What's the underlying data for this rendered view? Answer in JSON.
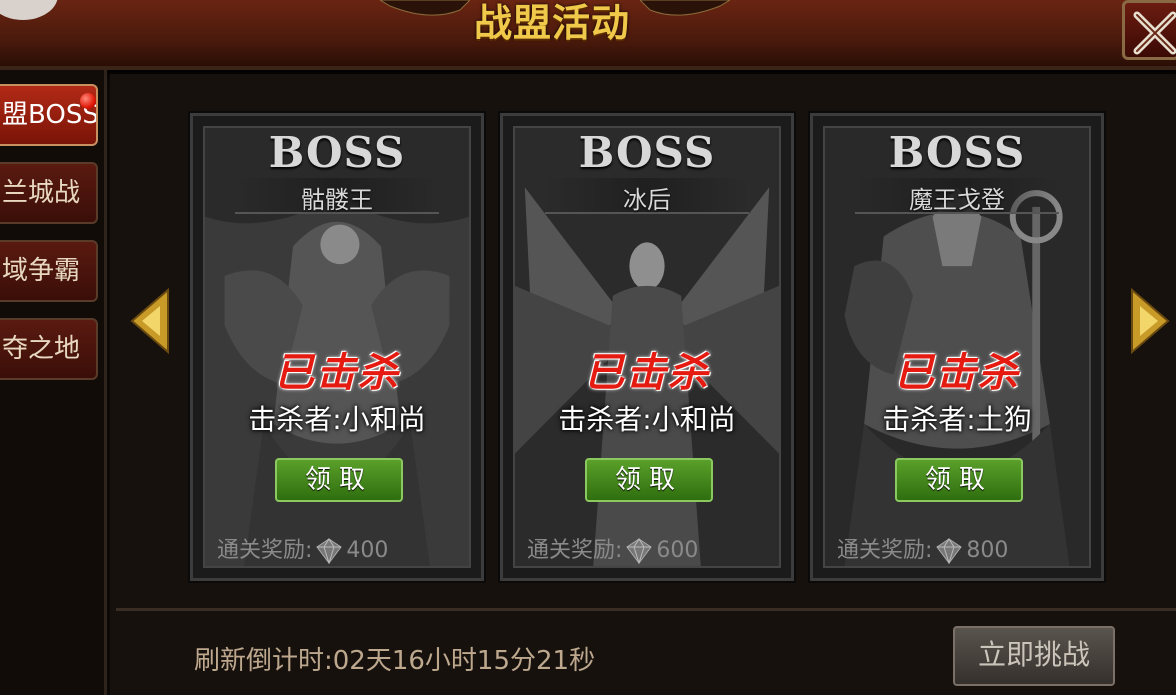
{
  "header": {
    "title": "战盟活动"
  },
  "sidebar": {
    "tabs": [
      {
        "label": "盟BOSS",
        "active": true,
        "badge": true
      },
      {
        "label": "兰城战",
        "active": false
      },
      {
        "label": "域争霸",
        "active": false
      },
      {
        "label": "夺之地",
        "active": false
      }
    ]
  },
  "cards": [
    {
      "header": "BOSS",
      "name": "骷髅王",
      "status": "已击杀",
      "killer": "击杀者:小和尚",
      "button": "领取",
      "reward_label": "通关奖励:",
      "reward_value": "400"
    },
    {
      "header": "BOSS",
      "name": "冰后",
      "status": "已击杀",
      "killer": "击杀者:小和尚",
      "button": "领取",
      "reward_label": "通关奖励:",
      "reward_value": "600"
    },
    {
      "header": "BOSS",
      "name": "魔王戈登",
      "status": "已击杀",
      "killer": "击杀者:土狗",
      "button": "领取",
      "reward_label": "通关奖励:",
      "reward_value": "800"
    }
  ],
  "footer": {
    "countdown": "刷新倒计时:02天16小时15分21秒",
    "challenge_button": "立即挑战"
  },
  "icons": {
    "close": "close-x-icon",
    "prev": "arrow-left-icon",
    "next": "arrow-right-icon",
    "reward": "gem-icon"
  },
  "colors": {
    "title": "#f0c84a",
    "killed": "#e51a10",
    "claim": "#3f8a18",
    "header_bg": "#5a1e0e"
  }
}
